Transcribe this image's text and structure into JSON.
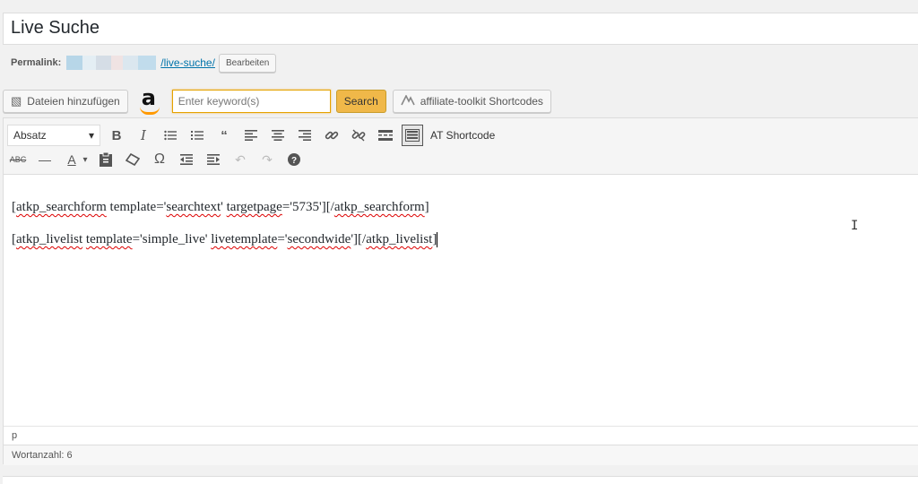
{
  "title": "Live Suche",
  "permalink": {
    "label": "Permalink:",
    "slug": "/live-suche/",
    "edit_label": "Bearbeiten"
  },
  "media": {
    "add_files_label": "Dateien hinzufügen",
    "keyword_placeholder": "Enter keyword(s)",
    "search_label": "Search",
    "shortcodes_label": "affiliate-toolkit Shortcodes",
    "amazon_logo": "a"
  },
  "toolbar": {
    "format_select": "Absatz",
    "at_shortcode_label": "AT Shortcode",
    "icons_row1": [
      "bold-icon",
      "italic-icon",
      "bullet-list-icon",
      "numbered-list-icon",
      "blockquote-icon",
      "align-left-icon",
      "align-center-icon",
      "align-right-icon",
      "link-icon",
      "unlink-icon",
      "read-more-icon",
      "toolbar-toggle-icon"
    ],
    "icons_row2": [
      "strikethrough-icon",
      "horizontal-line-icon",
      "text-color-icon",
      "paste-text-icon",
      "clear-formatting-icon",
      "special-character-icon",
      "outdent-icon",
      "indent-icon",
      "undo-icon",
      "redo-icon",
      "help-icon"
    ]
  },
  "content": {
    "line1": {
      "p1": "[",
      "w1": "atkp_searchform",
      "p2": " template='",
      "w2": "searchtext",
      "p3": "' ",
      "w3": "targetpage",
      "p4": "='5735'][/",
      "w4": "atkp_searchform",
      "p5": "]"
    },
    "line2": {
      "p1": "[",
      "w1": "atkp_livelist",
      "p2": " ",
      "w2": "template",
      "p3": "='simple_live' ",
      "w3": "livetemplate",
      "p4": "='",
      "w4": "secondwide",
      "p5": "'][/",
      "w5": "atkp_livelist",
      "p6": "]"
    }
  },
  "status": {
    "path": "p",
    "word_count": "Wortanzahl: 6"
  },
  "colors": {
    "accent": "#0073aa",
    "search_button": "#f0b849",
    "amazon_smile": "#ff9900"
  }
}
